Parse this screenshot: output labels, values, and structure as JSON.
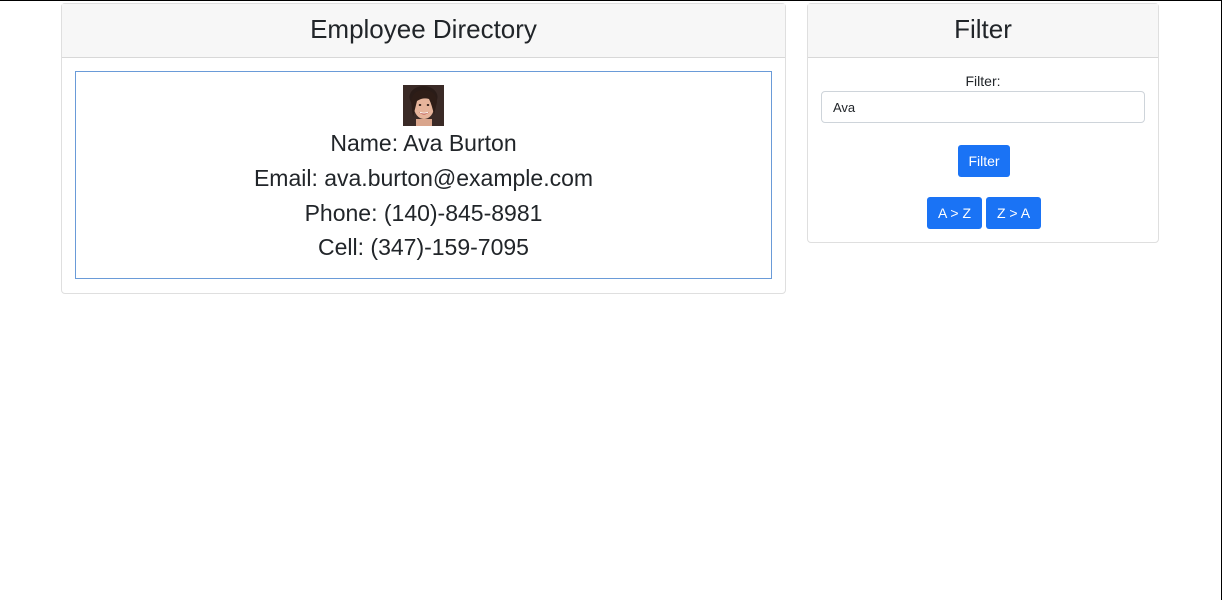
{
  "directory": {
    "title": "Employee Directory",
    "employee": {
      "name_line": "Name: Ava Burton",
      "email_line": "Email: ava.burton@example.com",
      "phone_line": "Phone: (140)-845-8981",
      "cell_line": "Cell: (347)-159-7095",
      "avatar_icon": "avatar-photo"
    }
  },
  "filter": {
    "title": "Filter",
    "label": "Filter:",
    "input_value": "Ava",
    "filter_button": "Filter",
    "sort_az": "A > Z",
    "sort_za": "Z > A"
  },
  "colors": {
    "accent": "#1a73f5",
    "card_border_highlight": "#6a9bd8",
    "header_bg": "#f7f7f7"
  }
}
